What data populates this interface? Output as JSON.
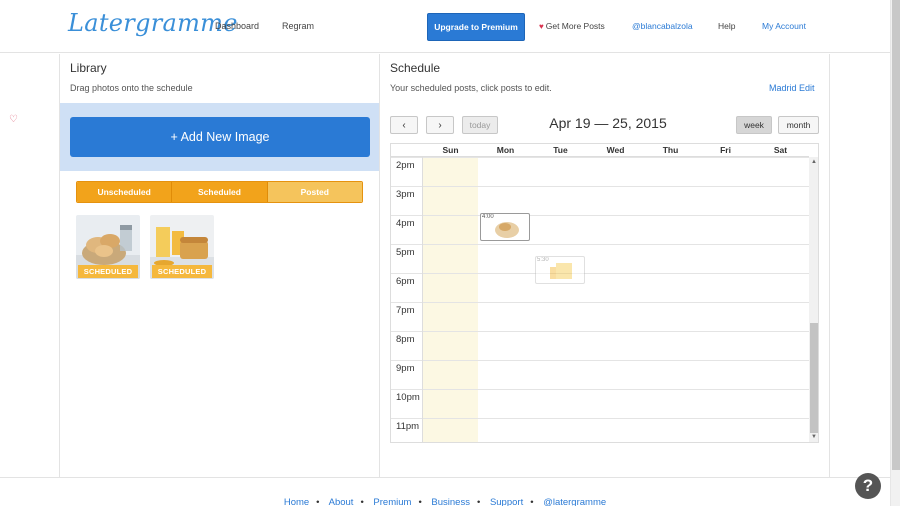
{
  "header": {
    "logo": "Latergramme",
    "nav_dashboard": "Dashboard",
    "nav_regram": "Regram",
    "upgrade": "Upgrade to Premium",
    "get_more": "Get More Posts",
    "handle": "@blancabalzola",
    "help": "Help",
    "account": "My Account"
  },
  "library": {
    "title": "Library",
    "subtitle": "Drag photos onto the schedule",
    "add_button": "+ Add New Image",
    "filters": [
      "Unscheduled",
      "Scheduled",
      "Posted"
    ],
    "active_filter": "Posted",
    "images": [
      {
        "badge": "SCHEDULED",
        "subject": "croissants"
      },
      {
        "badge": "SCHEDULED",
        "subject": "orange-juice-cake"
      }
    ]
  },
  "schedule": {
    "title": "Schedule",
    "subtitle": "Your scheduled posts, click posts to edit.",
    "timezone": "Madrid Edit",
    "prev": "‹",
    "next": "›",
    "today": "today",
    "range": "Apr 19 — 25, 2015",
    "view_week": "week",
    "view_month": "month",
    "days": [
      "Sun",
      "Mon",
      "Tue",
      "Wed",
      "Thu",
      "Fri",
      "Sat"
    ],
    "hours": [
      "2pm",
      "3pm",
      "4pm",
      "5pm",
      "6pm",
      "7pm",
      "8pm",
      "9pm",
      "10pm",
      "11pm"
    ],
    "events": [
      {
        "time": "4:00",
        "day": "Mon"
      },
      {
        "time": "5:30",
        "day": "Tue"
      }
    ]
  },
  "footer": {
    "links": [
      "Home",
      "About",
      "Premium",
      "Business",
      "Support",
      "@latergramme"
    ]
  },
  "colors": {
    "brand_blue": "#2a7ad5",
    "orange": "#f2a31b",
    "today_highlight": "#fcf8e3"
  }
}
